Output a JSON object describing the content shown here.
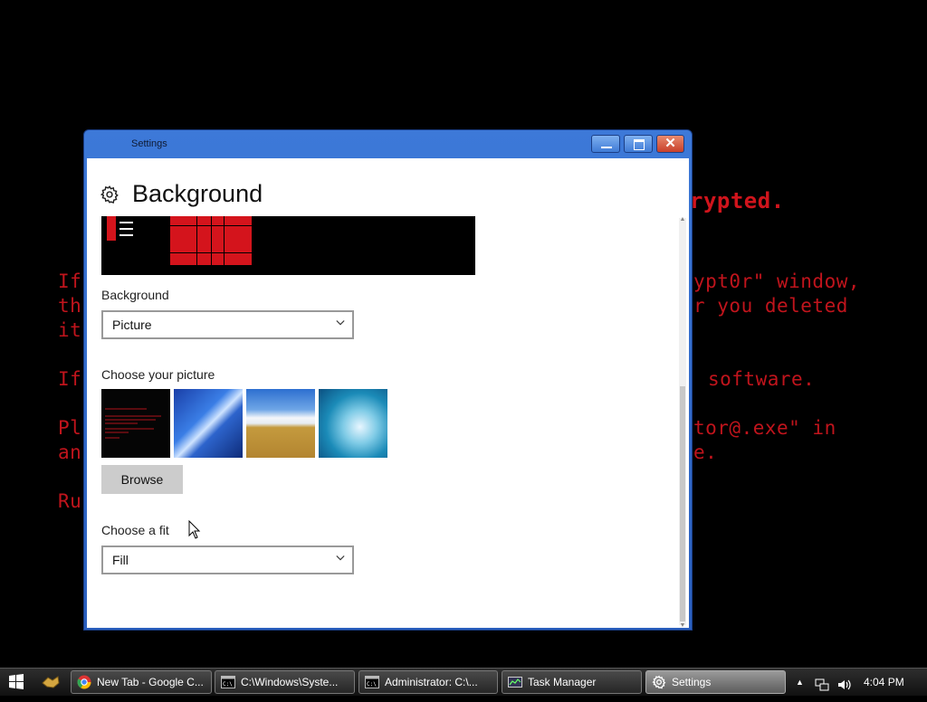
{
  "desktop": {
    "lines": [
      {
        "text": "rypted.",
        "cls": "big"
      },
      {
        "text": "If",
        "cls": ""
      },
      {
        "text": "ypt0r\" window,",
        "cls": ""
      },
      {
        "text": "th",
        "cls": ""
      },
      {
        "text": "r you deleted",
        "cls": ""
      },
      {
        "text": "it",
        "cls": ""
      },
      {
        "text": "If",
        "cls": ""
      },
      {
        "text": "software.",
        "cls": ""
      },
      {
        "text": "Pl",
        "cls": ""
      },
      {
        "text": "tor@.exe\" in",
        "cls": ""
      },
      {
        "text": "an",
        "cls": ""
      },
      {
        "text": "e.",
        "cls": ""
      },
      {
        "text": "Ru",
        "cls": ""
      }
    ]
  },
  "window": {
    "title": "Settings",
    "close_label": "✕"
  },
  "page": {
    "icon": "gear-icon",
    "title": "Background"
  },
  "background_section": {
    "label": "Background",
    "value": "Picture"
  },
  "picture_section": {
    "label": "Choose your picture",
    "thumbnails": [
      {
        "name": "dark-red-text-wallpaper"
      },
      {
        "name": "blue-streaks-wallpaper"
      },
      {
        "name": "wheat-field-sky-wallpaper"
      },
      {
        "name": "ocean-wave-wallpaper"
      }
    ],
    "browse_label": "Browse"
  },
  "fit_section": {
    "label": "Choose a fit",
    "value": "Fill"
  },
  "taskbar": {
    "items": [
      {
        "label": "New Tab - Google C...",
        "icon": "chrome-icon",
        "active": false
      },
      {
        "label": "C:\\Windows\\Syste...",
        "icon": "cmd-icon",
        "active": false
      },
      {
        "label": "Administrator: C:\\...",
        "icon": "cmd-icon",
        "active": false
      },
      {
        "label": "Task Manager",
        "icon": "task-manager-icon",
        "active": false
      },
      {
        "label": "Settings",
        "icon": "gear-icon",
        "active": true
      }
    ],
    "tray_arrow": "▲",
    "clock": "4:04 PM"
  },
  "colors": {
    "desktop_text": "#c0141c",
    "window_frame": "#3d79d8",
    "accent_red": "#d4141c"
  }
}
